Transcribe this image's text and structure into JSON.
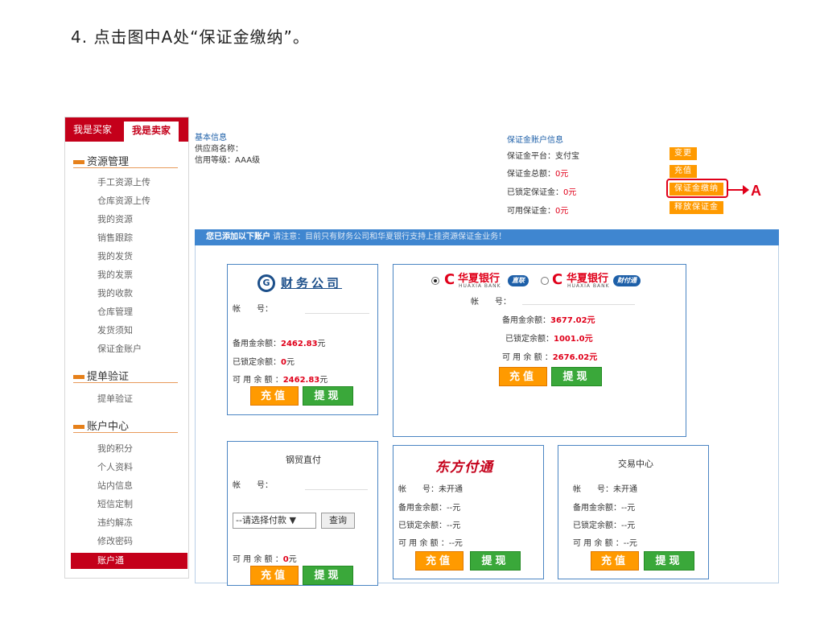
{
  "instruction": "4. 点击图中A处“保证金缴纳”。",
  "sidebar": {
    "tab_buyer": "我是买家",
    "tab_seller": "我是卖家",
    "sections": [
      {
        "title": "资源管理",
        "items": [
          "手工资源上传",
          "仓库资源上传",
          "我的资源",
          "销售跟踪",
          "我的发货",
          "我的发票",
          "我的收款",
          "仓库管理",
          "发货须知",
          "保证金账户"
        ]
      },
      {
        "title": "提单验证",
        "items": [
          "提单验证"
        ]
      },
      {
        "title": "账户中心",
        "items": [
          "我的积分",
          "个人资料",
          "站内信息",
          "短信定制",
          "违约解冻",
          "修改密码",
          "账户通"
        ]
      }
    ]
  },
  "basic_info": {
    "title": "基本信息",
    "supplier_label": "供应商名称：",
    "credit_label": "信用等级：AAA级"
  },
  "deposit_info": {
    "title": "保证金账户信息",
    "platform": "保证金平台：支付宝",
    "total_label": "保证金总额：",
    "total_value": "0元",
    "locked_label": "已锁定保证金：",
    "locked_value": "0元",
    "available_label": "可用保证金：",
    "available_value": "0元"
  },
  "actions": {
    "change": "变更",
    "recharge": "充值",
    "pay_deposit": "保证金缴纳",
    "release_deposit": "释放保证金"
  },
  "annotation_label": "A",
  "notice_bar": {
    "bold": "您已添加以下账户",
    "text": " 请注意：目前只有财务公司和华夏银行支持上挂资源保证金业务！"
  },
  "cards": {
    "caiwu": {
      "logo_text": "财务公司",
      "account_label": "帐　　号：",
      "reserve_label": "备用金余额：",
      "reserve_value": "2462.83",
      "reserve_unit": "元",
      "locked_label": "已锁定余额：",
      "locked_value": "0",
      "locked_unit": "元",
      "available_label": "可 用 余 额 ：",
      "available_value": "2462.83",
      "available_unit": "元",
      "recharge": "充值",
      "withdraw": "提现"
    },
    "huaxia": {
      "bank_name": "华夏银行",
      "bank_en": "HUAXIA BANK",
      "badge_direct": "直联",
      "badge_ftt": "财付通",
      "account_label": "帐　　号：",
      "reserve_label": "备用金余额：",
      "reserve_value": "3677.02元",
      "locked_label": "已锁定余额：",
      "locked_value": "1001.0元",
      "available_label": "可 用 余 额 ：",
      "available_value": "2676.02元",
      "recharge": "充值",
      "withdraw": "提现"
    },
    "gangmao": {
      "title": "钢贸直付",
      "account_label": "帐　　号：",
      "select_value": "--请选择付款",
      "query": "查询",
      "available_label": "可 用 余 额 ：",
      "available_value": "0",
      "available_unit": "元",
      "recharge": "充值",
      "withdraw": "提现"
    },
    "dongfang": {
      "logo_text": "东方付通",
      "account_label": "帐　　号：",
      "account_value": "未开通",
      "reserve_label": "备用金余额：",
      "reserve_value": "--元",
      "locked_label": "已锁定余额：",
      "locked_value": "--元",
      "available_label": "可 用 余 额 ：",
      "available_value": "--元",
      "recharge": "充值",
      "withdraw": "提现"
    },
    "jiaoyi": {
      "title": "交易中心",
      "account_label": "帐　　号：",
      "account_value": "未开通",
      "reserve_label": "备用金余额：",
      "reserve_value": "--元",
      "locked_label": "已锁定余额：",
      "locked_value": "--元",
      "available_label": "可 用 余 额 ：",
      "available_value": "--元",
      "recharge": "充值",
      "withdraw": "提现"
    }
  },
  "colors": {
    "brand_red": "#c4001a",
    "orange": "#ff9a00",
    "green": "#3aa83a",
    "blue_bar": "#3f86d0"
  }
}
